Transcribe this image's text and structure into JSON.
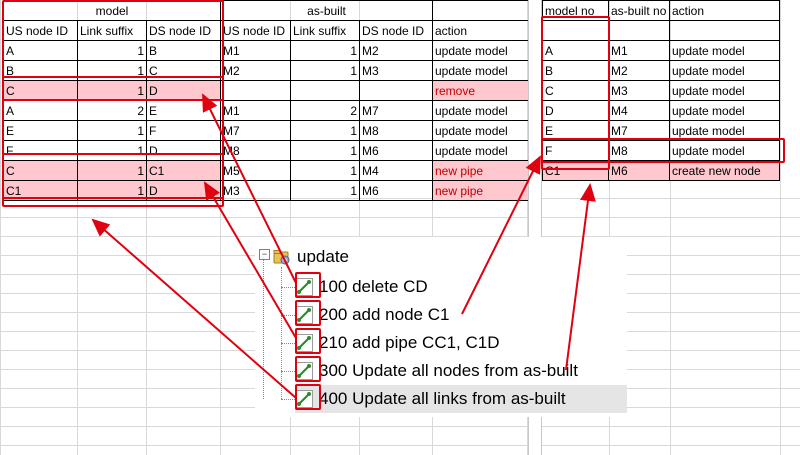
{
  "model_table": {
    "group_header": "model",
    "columns": [
      "US node ID",
      "Link suffix",
      "DS node ID"
    ],
    "rows": [
      {
        "us": "A",
        "suffix": "1",
        "ds": "B"
      },
      {
        "us": "B",
        "suffix": "1",
        "ds": "C"
      },
      {
        "us": "C",
        "suffix": "1",
        "ds": "D"
      },
      {
        "us": "A",
        "suffix": "2",
        "ds": "E"
      },
      {
        "us": "E",
        "suffix": "1",
        "ds": "F"
      },
      {
        "us": "F",
        "suffix": "1",
        "ds": "D"
      },
      {
        "us": "C",
        "suffix": "1",
        "ds": "C1"
      },
      {
        "us": "C1",
        "suffix": "1",
        "ds": "D"
      }
    ]
  },
  "asbuilt_table": {
    "group_header": "as-built",
    "columns": [
      "US node ID",
      "Link suffix",
      "DS node ID",
      "action"
    ],
    "rows": [
      {
        "us": "M1",
        "suffix": "1",
        "ds": "M2",
        "action": "update model"
      },
      {
        "us": "M2",
        "suffix": "1",
        "ds": "M3",
        "action": "update model"
      },
      {
        "us": "",
        "suffix": "",
        "ds": "",
        "action": "remove"
      },
      {
        "us": "M1",
        "suffix": "2",
        "ds": "M7",
        "action": "update model"
      },
      {
        "us": "M7",
        "suffix": "1",
        "ds": "M8",
        "action": "update model"
      },
      {
        "us": "M8",
        "suffix": "1",
        "ds": "M6",
        "action": "update model"
      },
      {
        "us": "M5",
        "suffix": "1",
        "ds": "M4",
        "action": "new pipe"
      },
      {
        "us": "M3",
        "suffix": "1",
        "ds": "M6",
        "action": "new pipe"
      }
    ]
  },
  "node_table": {
    "columns": [
      "model no",
      "as-built no",
      "action"
    ],
    "rows": [
      {
        "model": "A",
        "asbuilt": "M1",
        "action": "update model"
      },
      {
        "model": "B",
        "asbuilt": "M2",
        "action": "update model"
      },
      {
        "model": "C",
        "asbuilt": "M3",
        "action": "update model"
      },
      {
        "model": "D",
        "asbuilt": "M4",
        "action": "update model"
      },
      {
        "model": "E",
        "asbuilt": "M7",
        "action": "update model"
      },
      {
        "model": "F",
        "asbuilt": "M8",
        "action": "update model"
      },
      {
        "model": "C1",
        "asbuilt": "M6",
        "action": "create new node"
      }
    ]
  },
  "tree": {
    "root_label": "update",
    "collapse_glyph": "−",
    "items": [
      {
        "label": "100 delete CD"
      },
      {
        "label": "200 add node C1"
      },
      {
        "label": "210 add pipe CC1, C1D"
      },
      {
        "label": "300 Update all nodes from as-built"
      },
      {
        "label": "400 Update all links from as-built"
      }
    ]
  },
  "colors": {
    "highlight_row": "#ffc7ce",
    "annotation_red": "#e0000f",
    "action_red_text": "#c00000"
  },
  "icons": {
    "root": "folder-gear-icon",
    "item": "link-pipe-icon"
  }
}
